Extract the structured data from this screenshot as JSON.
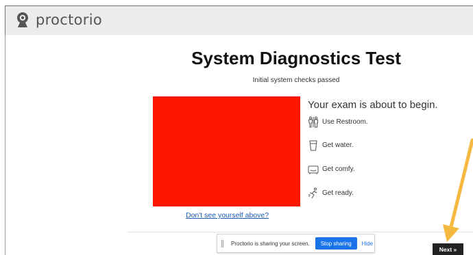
{
  "header": {
    "brand": "proctorio",
    "logo_icon": "webcam-icon"
  },
  "main": {
    "title": "System Diagnostics Test",
    "subtitle": "Initial system checks passed",
    "camera_preview_color": "#ff1500",
    "preview_help_link": "Don't see yourself above?"
  },
  "tips": {
    "heading": "Your exam is about to begin.",
    "items": [
      {
        "icon": "restroom-icon",
        "label": "Use Restroom."
      },
      {
        "icon": "water-glass-icon",
        "label": "Get water."
      },
      {
        "icon": "couch-icon",
        "label": "Get comfy."
      },
      {
        "icon": "runner-icon",
        "label": "Get ready."
      }
    ]
  },
  "share_bar": {
    "message": "Proctorio is sharing your screen.",
    "stop_label": "Stop sharing",
    "hide_label": "Hide"
  },
  "footer": {
    "next_label": "Next »"
  },
  "colors": {
    "accent_blue": "#1a73e8",
    "annotation_arrow": "#f5b942"
  }
}
